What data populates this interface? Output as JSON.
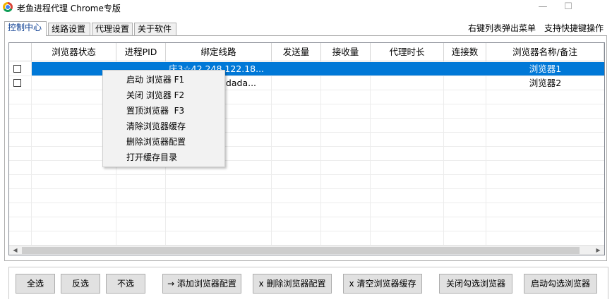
{
  "window": {
    "title": "老鱼进程代理 Chrome专版",
    "minimize_glyph": "—",
    "maximize_glyph": "☐"
  },
  "tabs": [
    {
      "label": "控制中心"
    },
    {
      "label": "线路设置"
    },
    {
      "label": "代理设置"
    },
    {
      "label": "关于软件"
    }
  ],
  "hints": [
    "右键列表弹出菜单",
    "支持快捷键操作"
  ],
  "table": {
    "columns": [
      "浏览器状态",
      "进程PID",
      "绑定线路",
      "发送量",
      "接收量",
      "代理时长",
      "连接数",
      "浏览器名称/备注"
    ],
    "rows": [
      {
        "status": "",
        "pid": "",
        "line": "庆3☆42.248.122.18...",
        "sent": "",
        "received": "",
        "duration": "",
        "connections": "",
        "name": "浏览器1",
        "checked": false,
        "selected": true
      },
      {
        "status": "",
        "pid": "",
        "line": "9.dada...",
        "sent": "",
        "received": "",
        "duration": "",
        "connections": "",
        "name": "浏览器2",
        "checked": false,
        "selected": false
      }
    ]
  },
  "context_menu": {
    "items": [
      "启动 浏览器 F1",
      "关闭 浏览器 F2",
      "置顶浏览器  F3",
      "清除浏览器缓存",
      "删除浏览器配置",
      "打开缓存目录"
    ]
  },
  "scrollbar": {
    "left_arrow": "◀",
    "right_arrow": "▶"
  },
  "buttons": {
    "select_all": "全选",
    "invert": "反选",
    "select_none": "不选",
    "add_config": "→ 添加浏览器配置",
    "delete_config": "x 删除浏览器配置",
    "clear_cache": "x 清空浏览器缓存",
    "close_checked": "关闭勾选浏览器",
    "start_checked": "启动勾选浏览器"
  },
  "colors": {
    "selection": "#0078d7",
    "active_tab_text": "#0b3d91"
  }
}
